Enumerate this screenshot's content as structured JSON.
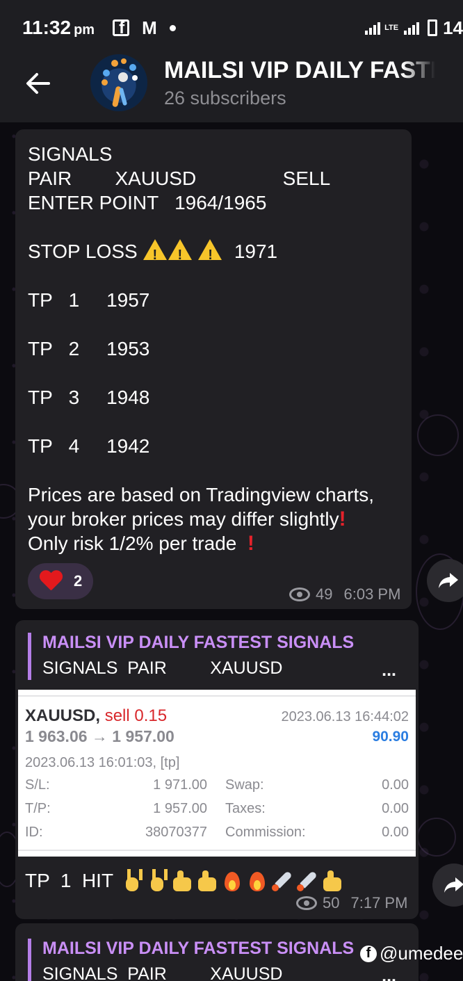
{
  "status_bar": {
    "time": "11:32",
    "ampm": "pm",
    "network": "LTE",
    "battery": "14"
  },
  "header": {
    "title": "MAILSI VIP DAILY FASTEST SIGNALS",
    "subtitle": "26 subscribers"
  },
  "messages": [
    {
      "lines": [
        "SIGNALS",
        "PAIR        XAUUSD                SELL",
        "ENTER POINT   1964/1965"
      ],
      "stop_loss_label": "STOP LOSS",
      "stop_loss_value": "1971",
      "tp_lines": [
        "TP   1     1957",
        "TP   2     1953",
        "TP   3     1948",
        "TP   4     1942"
      ],
      "disclaimer_1": "Prices are based on Tradingview charts,",
      "disclaimer_2": "your broker prices may differ slightly",
      "disclaimer_3": "Only risk 1/2% per trade",
      "reaction_count": "2",
      "views": "49",
      "time": "6:03 PM"
    },
    {
      "reply_title": "MAILSI VIP DAILY FASTEST SIGNALS",
      "reply_text": "SIGNALS  PAIR         XAUUSD",
      "reply_ellipsis": "...",
      "trade": {
        "symbol": "XAUUSD,",
        "side": "sell 0.15",
        "close_time": "2023.06.13 16:44:02",
        "price_range": "1 963.06 → 1 957.00",
        "profit": "90.90",
        "open_time": "2023.06.13 16:01:03, [tp]",
        "rows": [
          {
            "k1": "S/L:",
            "v1": "1 971.00",
            "k2": "Swap:",
            "v2": "0.00"
          },
          {
            "k1": "T/P:",
            "v1": "1 957.00",
            "k2": "Taxes:",
            "v2": "0.00"
          },
          {
            "k1": "ID:",
            "v1": "38070377",
            "k2": "Commission:",
            "v2": "0.00"
          }
        ]
      },
      "caption": "TP  1  HIT",
      "views": "50",
      "time": "7:17 PM"
    },
    {
      "reply_title": "MAILSI VIP DAILY FASTEST SIGNALS",
      "reply_text": "SIGNALS  PAIR         XAUUSD",
      "reply_ellipsis": "..."
    }
  ],
  "watermark": "@umedee",
  "colors": {
    "bubble": "#212024",
    "accent_purple": "#c98ff6",
    "reaction_bg": "#3a2f45",
    "sell_red": "#d8272b",
    "profit_blue": "#2a7de1"
  },
  "icons": [
    "back-arrow-icon",
    "eye-icon",
    "share-icon",
    "heart-icon",
    "warning-icon",
    "facebook-icon",
    "mail-icon"
  ]
}
